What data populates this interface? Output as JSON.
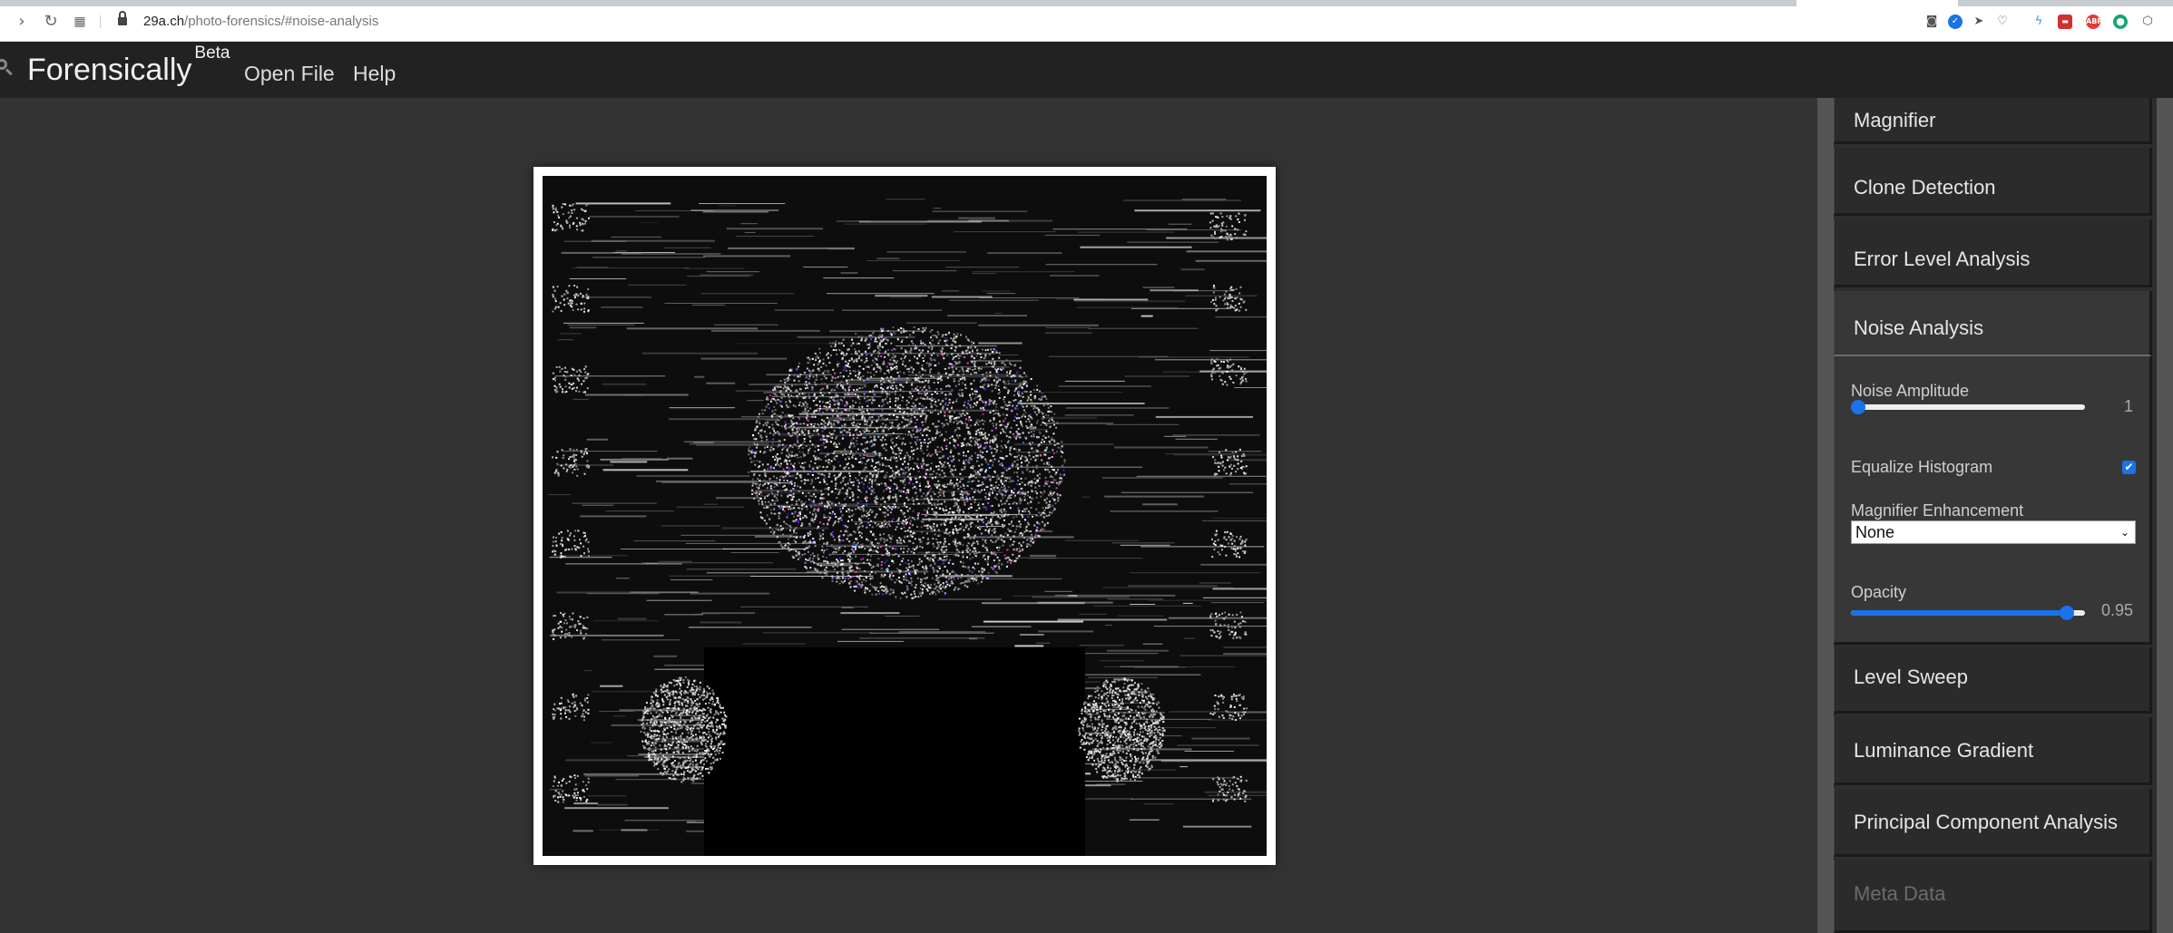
{
  "browser": {
    "url_host": "29a.ch",
    "url_path": "/photo-forensics/#noise-analysis"
  },
  "app": {
    "title": "Forensically",
    "title_sup": "Beta",
    "menu": [
      "Open File",
      "Help"
    ]
  },
  "tools": [
    {
      "label": "Magnifier"
    },
    {
      "label": "Clone Detection"
    },
    {
      "label": "Error Level Analysis"
    },
    {
      "label": "Noise Analysis"
    },
    {
      "label": "Level Sweep"
    },
    {
      "label": "Luminance Gradient"
    },
    {
      "label": "Principal Component Analysis"
    },
    {
      "label": "Meta Data"
    }
  ],
  "noise_panel": {
    "noise_amplitude_label": "Noise Amplitude",
    "noise_amplitude_value": "1",
    "noise_amplitude_fraction": 0.0,
    "equalize_label": "Equalize Histogram",
    "equalize_checked": true,
    "magnifier_label": "Magnifier Enhancement",
    "magnifier_value": "None",
    "opacity_label": "Opacity",
    "opacity_value": "0.95",
    "opacity_fraction": 0.95
  },
  "colors": {
    "accent": "#1a73e8",
    "header_bg": "#222222",
    "page_bg": "#333333"
  }
}
